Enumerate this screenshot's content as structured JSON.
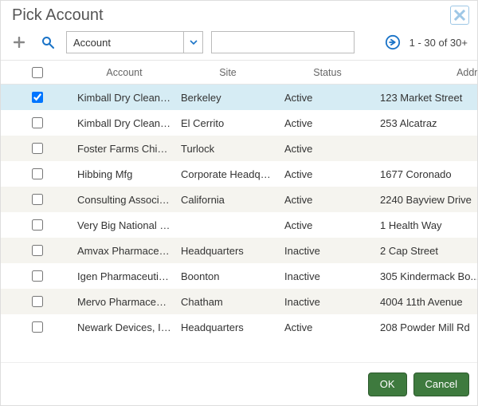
{
  "dialog": {
    "title": "Pick Account"
  },
  "toolbar": {
    "filter_field_value": "Account",
    "filter_text_value": "",
    "pagination": "1 - 30 of 30+"
  },
  "columns": {
    "account": "Account",
    "site": "Site",
    "status": "Status",
    "address": "Address"
  },
  "rows": [
    {
      "checked": true,
      "account": "Kimball Dry Cleaners",
      "site": "Berkeley",
      "status": "Active",
      "address": "123 Market Street"
    },
    {
      "checked": false,
      "account": "Kimball Dry Cleaners",
      "site": "El Cerrito",
      "status": "Active",
      "address": "253 Alcatraz"
    },
    {
      "checked": false,
      "account": "Foster Farms Chick...",
      "site": "Turlock",
      "status": "Active",
      "address": ""
    },
    {
      "checked": false,
      "account": "Hibbing Mfg",
      "site": "Corporate Headqua...",
      "status": "Active",
      "address": "1677 Coronado"
    },
    {
      "checked": false,
      "account": "Consulting Associa...",
      "site": "California",
      "status": "Active",
      "address": "2240 Bayview Drive"
    },
    {
      "checked": false,
      "account": "Very Big National H...",
      "site": "",
      "status": "Active",
      "address": "1 Health Way"
    },
    {
      "checked": false,
      "account": "Amvax Pharmaceut...",
      "site": "Headquarters",
      "status": "Inactive",
      "address": "2 Cap Street"
    },
    {
      "checked": false,
      "account": "Igen Pharmaceutic...",
      "site": "Boonton",
      "status": "Inactive",
      "address": "305 Kindermack Bo..."
    },
    {
      "checked": false,
      "account": "Mervo Pharmaceuti...",
      "site": "Chatham",
      "status": "Inactive",
      "address": "4004 11th Avenue"
    },
    {
      "checked": false,
      "account": "Newark Devices, Inc.",
      "site": "Headquarters",
      "status": "Active",
      "address": "208 Powder Mill Rd"
    }
  ],
  "footer": {
    "ok": "OK",
    "cancel": "Cancel"
  }
}
